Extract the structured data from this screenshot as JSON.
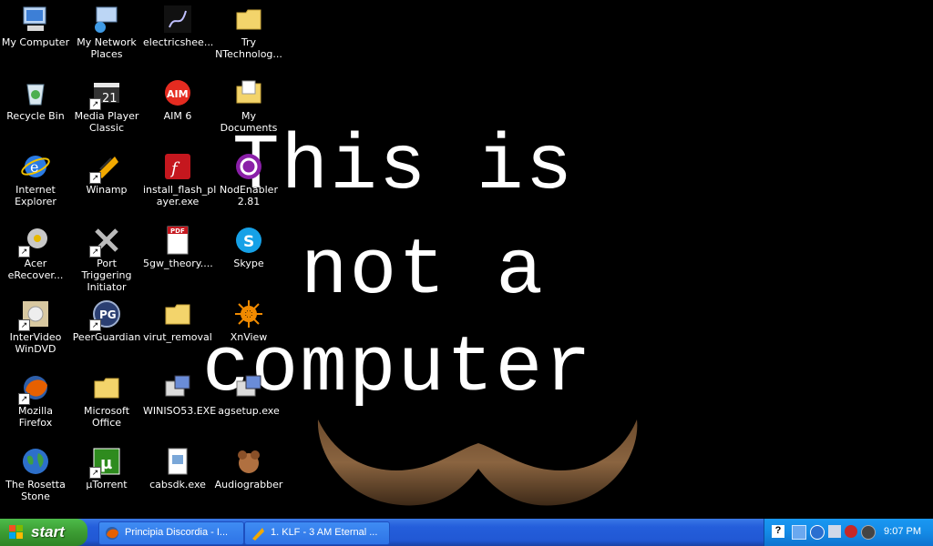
{
  "wallpaper": {
    "line1": "This is",
    "line2": "not a",
    "line3": "computer"
  },
  "icons": [
    {
      "label": "My Computer",
      "icon": "my-computer-icon"
    },
    {
      "label": "My Network Places",
      "icon": "network-places-icon"
    },
    {
      "label": "electricshee...",
      "icon": "electricsheep-icon"
    },
    {
      "label": "Try NTechnolog...",
      "icon": "folder-icon"
    },
    {
      "label": "Recycle Bin",
      "icon": "recycle-bin-icon"
    },
    {
      "label": "Media Player Classic",
      "icon": "media-player-icon"
    },
    {
      "label": "AIM 6",
      "icon": "aim-icon"
    },
    {
      "label": "My Documents",
      "icon": "my-documents-icon"
    },
    {
      "label": "Internet Explorer",
      "icon": "internet-explorer-icon"
    },
    {
      "label": "Winamp",
      "icon": "winamp-icon"
    },
    {
      "label": "install_flash_pl ayer.exe",
      "icon": "flash-installer-icon"
    },
    {
      "label": "NodEnabler 2.81",
      "icon": "nodenabler-icon"
    },
    {
      "label": "Acer eRecover...",
      "icon": "acer-erecovery-icon"
    },
    {
      "label": "Port Triggering Initiator",
      "icon": "port-triggering-icon"
    },
    {
      "label": "5gw_theory....",
      "icon": "pdf-icon"
    },
    {
      "label": "Skype",
      "icon": "skype-icon"
    },
    {
      "label": "InterVideo WinDVD",
      "icon": "windvd-icon"
    },
    {
      "label": "PeerGuardian",
      "icon": "peerguardian-icon"
    },
    {
      "label": "virut_removal",
      "icon": "folder-icon"
    },
    {
      "label": "XnView",
      "icon": "xnview-icon"
    },
    {
      "label": "Mozilla Firefox",
      "icon": "firefox-icon"
    },
    {
      "label": "Microsoft Office",
      "icon": "folder-icon"
    },
    {
      "label": "WINISO53.EXE",
      "icon": "setup-exe-icon"
    },
    {
      "label": "agsetup.exe",
      "icon": "setup-exe-icon"
    },
    {
      "label": "The Rosetta Stone",
      "icon": "globe-icon"
    },
    {
      "label": "µTorrent",
      "icon": "utorrent-icon"
    },
    {
      "label": "cabsdk.exe",
      "icon": "exe-file-icon"
    },
    {
      "label": "Audiograbber",
      "icon": "audiograbber-icon"
    }
  ],
  "taskbar": {
    "start_label": "start",
    "tasks": [
      {
        "label": "Principia Discordia - I...",
        "icon": "firefox-icon"
      },
      {
        "label": "1. KLF - 3 AM Eternal ...",
        "icon": "winamp-icon"
      }
    ],
    "clock": "9:07 PM"
  }
}
